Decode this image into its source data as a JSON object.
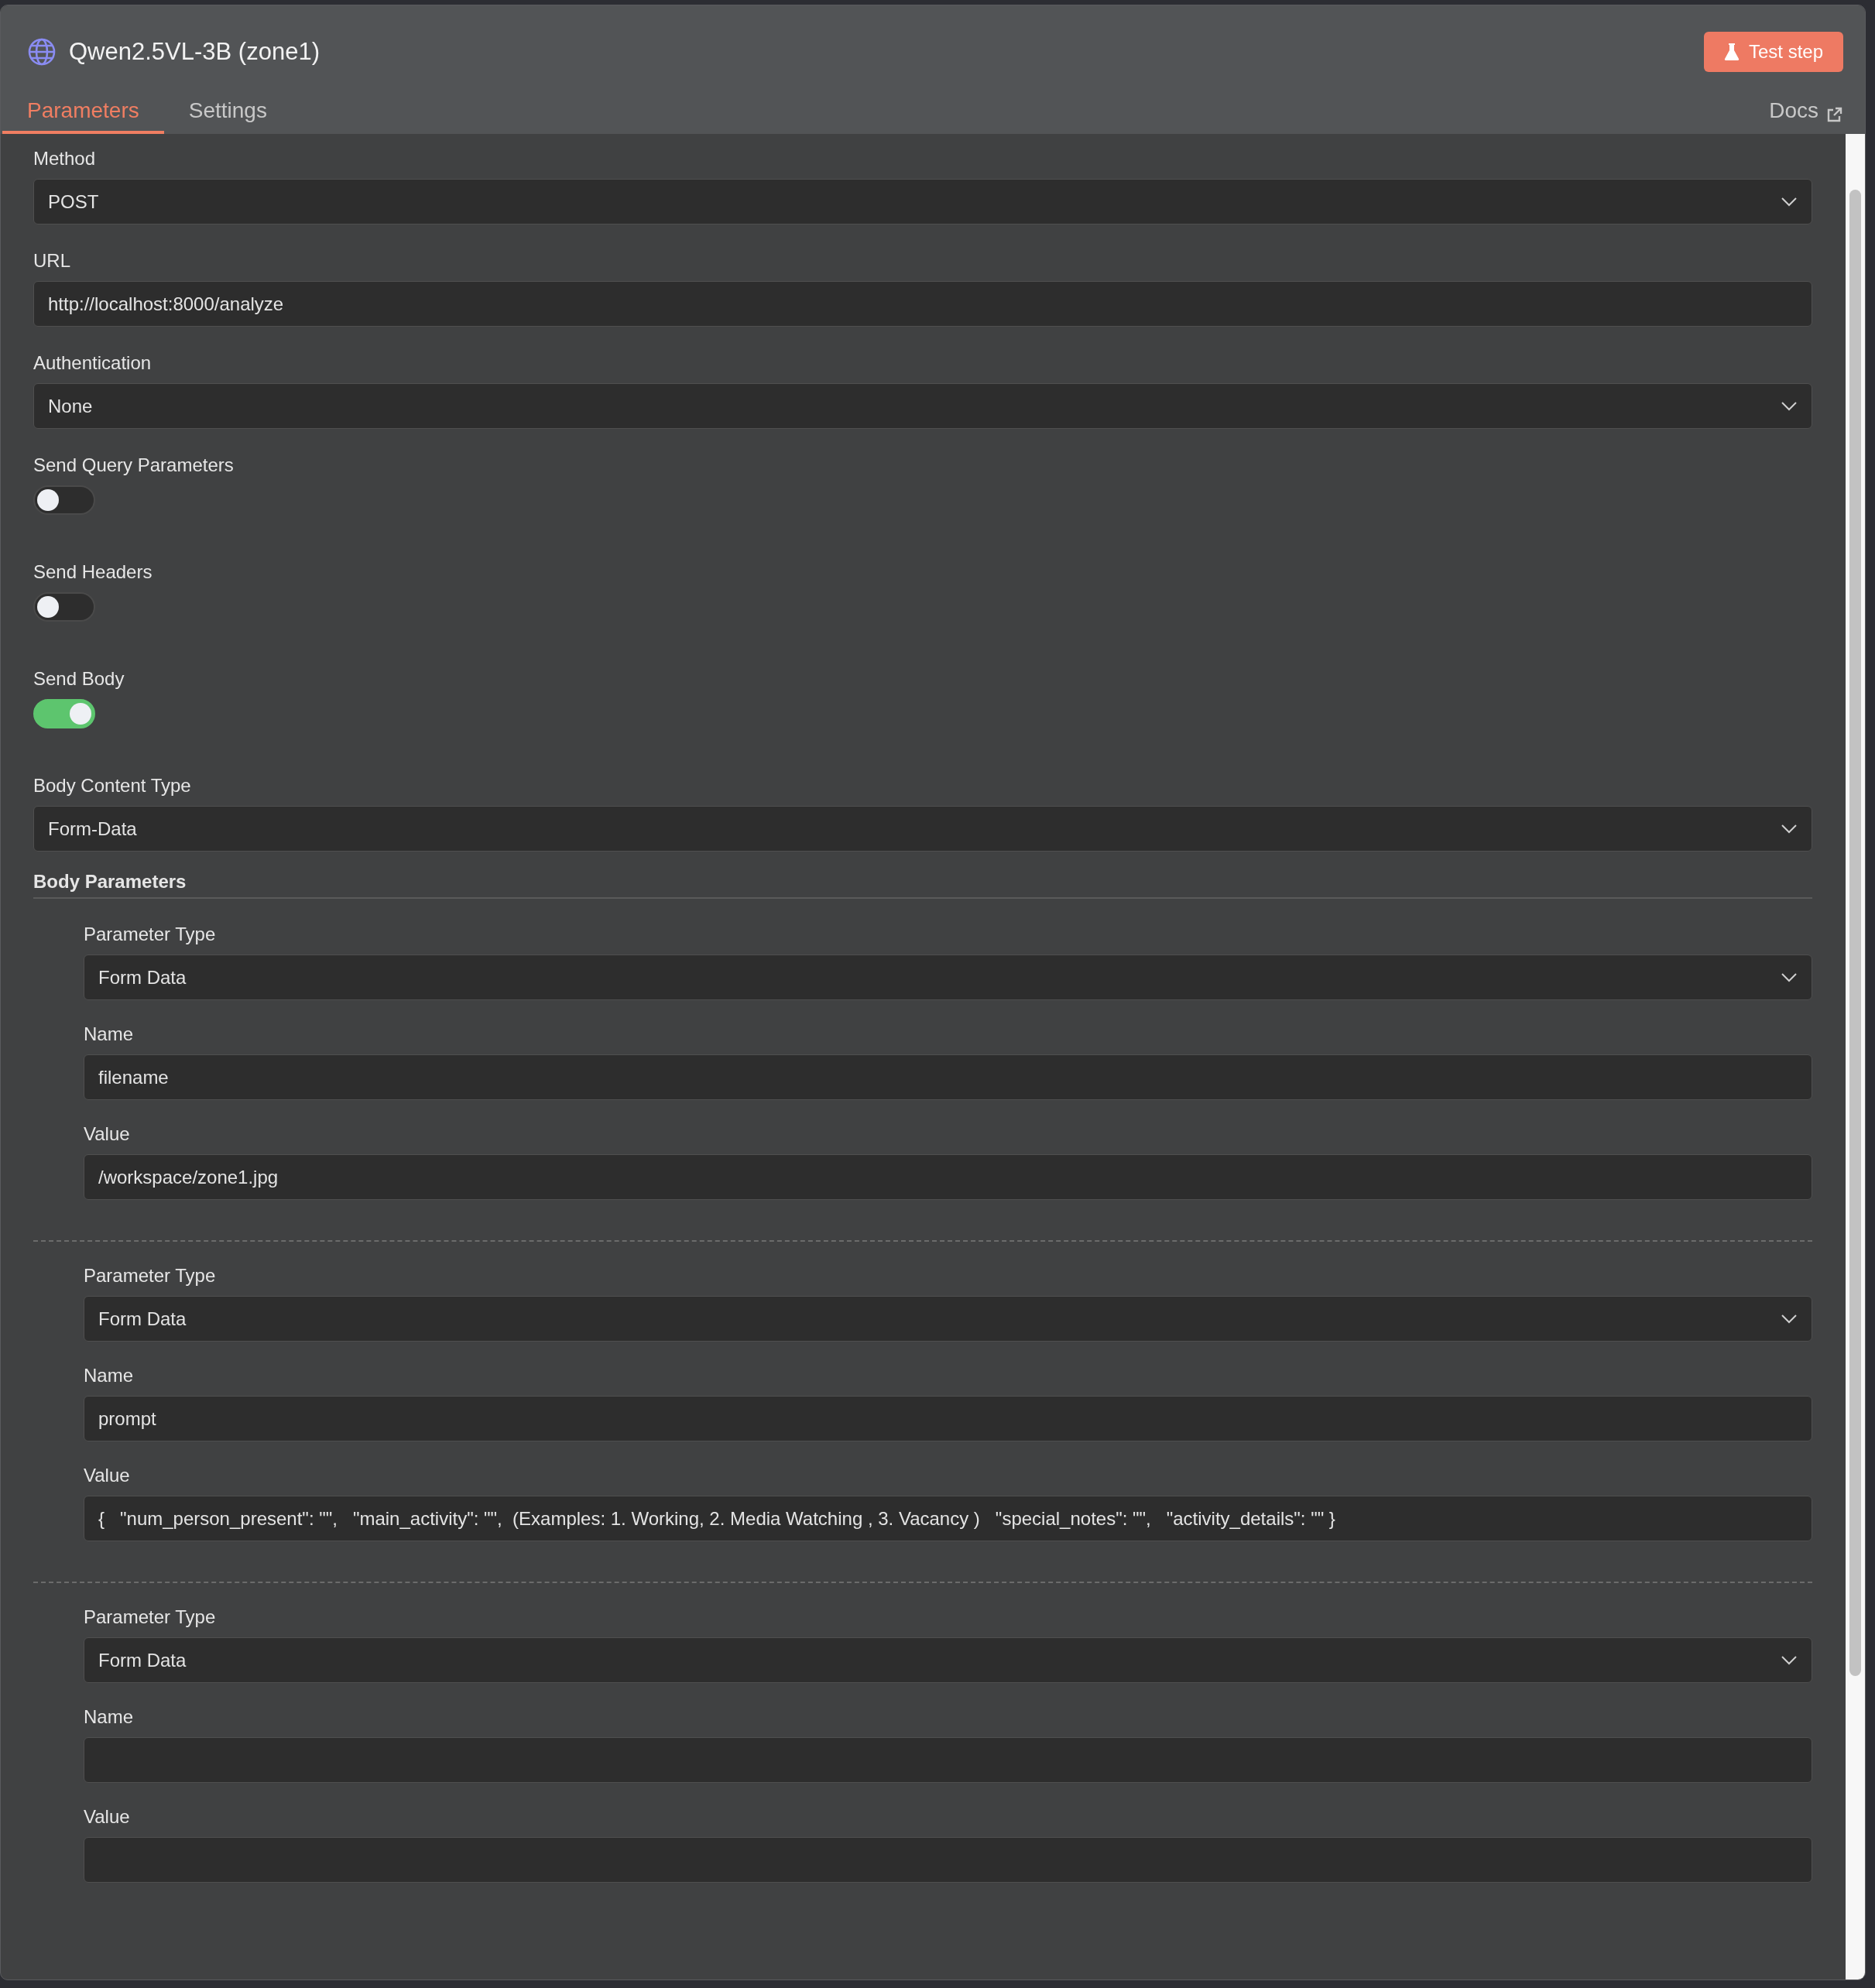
{
  "node": {
    "title": "Qwen2.5VL-3B (zone1)",
    "test_button": "Test step"
  },
  "tabs": [
    {
      "label": "Parameters",
      "selected": true
    },
    {
      "label": "Settings",
      "selected": false
    }
  ],
  "docs_link": "Docs",
  "fields": [
    {
      "kind": "select",
      "label": "Method",
      "value": "POST"
    },
    {
      "kind": "input",
      "label": "URL",
      "value": "http://localhost:8000/analyze"
    },
    {
      "kind": "select",
      "label": "Authentication",
      "value": "None"
    },
    {
      "kind": "toggle",
      "label": "Send Query Parameters",
      "on": false
    },
    {
      "kind": "toggle",
      "label": "Send Headers",
      "on": false
    },
    {
      "kind": "toggle",
      "label": "Send Body",
      "on": true
    },
    {
      "kind": "select",
      "label": "Body Content Type",
      "value": "Form-Data"
    }
  ],
  "body_parameters": {
    "title": "Body Parameters",
    "items": [
      {
        "fields": [
          {
            "kind": "select",
            "label": "Parameter Type",
            "value": "Form Data"
          },
          {
            "kind": "input",
            "label": "Name",
            "value": "filename"
          },
          {
            "kind": "input",
            "label": "Value",
            "value": "/workspace/zone1.jpg"
          }
        ]
      },
      {
        "fields": [
          {
            "kind": "select",
            "label": "Parameter Type",
            "value": "Form Data"
          },
          {
            "kind": "input",
            "label": "Name",
            "value": "prompt"
          },
          {
            "kind": "input",
            "label": "Value",
            "value": "{   \"num_person_present\": \"\",   \"main_activity\": \"\",  (Examples: 1. Working, 2. Media Watching , 3. Vacancy )   \"special_notes\": \"\",   \"activity_details\": \"\" }"
          }
        ]
      },
      {
        "fields": [
          {
            "kind": "select",
            "label": "Parameter Type",
            "value": "Form Data"
          },
          {
            "kind": "input",
            "label": "Name"
          },
          {
            "kind": "input",
            "label": "Value"
          }
        ]
      }
    ]
  }
}
